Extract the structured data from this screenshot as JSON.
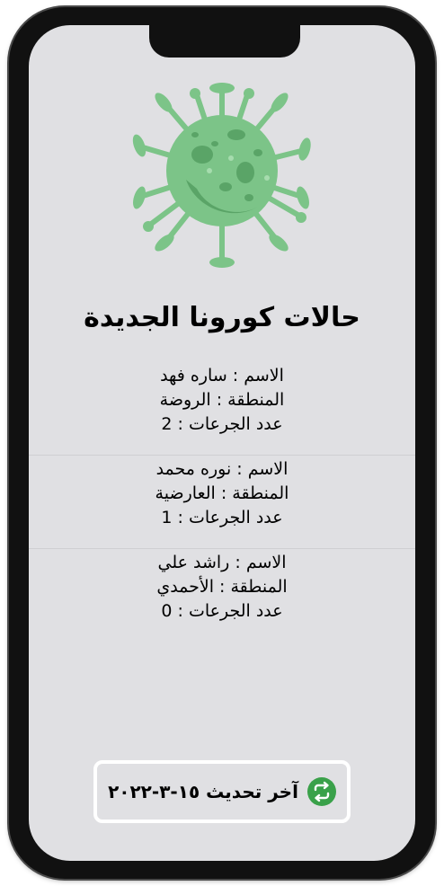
{
  "title": "حالات كورونا الجديدة",
  "cases": [
    {
      "name_line": "الاسم : ساره فهد",
      "region_line": "المنطقة : الروضة",
      "doses_line": "عدد الجرعات : 2"
    },
    {
      "name_line": "الاسم : نوره محمد",
      "region_line": "المنطقة : العارضية",
      "doses_line": "عدد الجرعات : 1"
    },
    {
      "name_line": "الاسم : راشد علي",
      "region_line": "المنطقة : الأحمدي",
      "doses_line": "عدد الجرعات : 0"
    }
  ],
  "update_button": {
    "label": "آخر تحديث ١٥-٣-٢٠٢٢",
    "icon": "refresh-icon"
  },
  "colors": {
    "screen_background": "#e0e0e3",
    "virus_green": "#7cc488",
    "virus_dark_green": "#5aa467",
    "refresh_icon_green": "#3aa14a"
  }
}
